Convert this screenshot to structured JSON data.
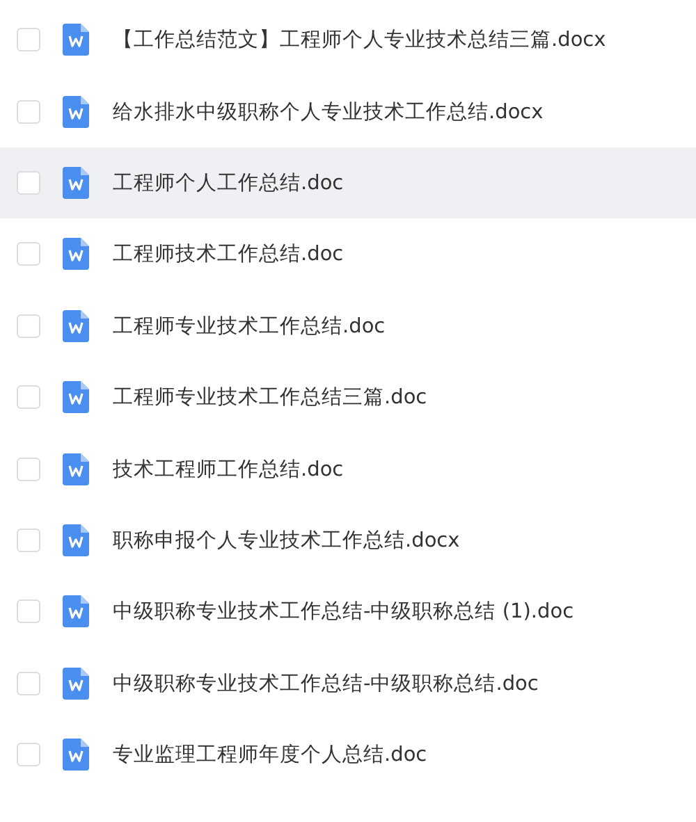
{
  "files": [
    {
      "name": "【工作总结范文】工程师个人专业技术总结三篇.docx",
      "checked": false,
      "highlighted": false
    },
    {
      "name": "给水排水中级职称个人专业技术工作总结.docx",
      "checked": false,
      "highlighted": false
    },
    {
      "name": "工程师个人工作总结.doc",
      "checked": false,
      "highlighted": true
    },
    {
      "name": "工程师技术工作总结.doc",
      "checked": false,
      "highlighted": false
    },
    {
      "name": "工程师专业技术工作总结.doc",
      "checked": false,
      "highlighted": false
    },
    {
      "name": "工程师专业技术工作总结三篇.doc",
      "checked": false,
      "highlighted": false
    },
    {
      "name": "技术工程师工作总结.doc",
      "checked": false,
      "highlighted": false
    },
    {
      "name": "职称申报个人专业技术工作总结.docx",
      "checked": false,
      "highlighted": false
    },
    {
      "name": "中级职称专业技术工作总结-中级职称总结 (1).doc",
      "checked": false,
      "highlighted": false
    },
    {
      "name": "中级职称专业技术工作总结-中级职称总结.doc",
      "checked": false,
      "highlighted": false
    },
    {
      "name": "专业监理工程师年度个人总结.doc",
      "checked": false,
      "highlighted": false
    }
  ]
}
